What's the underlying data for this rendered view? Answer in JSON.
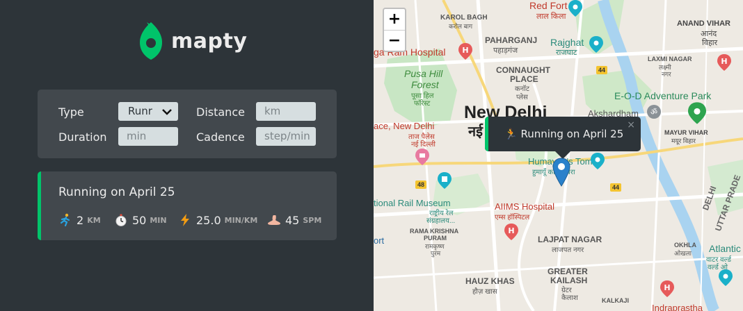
{
  "app": {
    "name": "mapty"
  },
  "form": {
    "type_label": "Type",
    "type_value": "Runr",
    "distance_label": "Distance",
    "distance_placeholder": "km",
    "duration_label": "Duration",
    "duration_placeholder": "min",
    "cadence_label": "Cadence",
    "cadence_placeholder": "step/min"
  },
  "workouts": [
    {
      "title": "Running on April 25",
      "distance": "2",
      "distance_unit": "km",
      "duration": "50",
      "duration_unit": "min",
      "pace": "25.0",
      "pace_unit": "min/km",
      "cadence": "45",
      "cadence_unit": "spm"
    }
  ],
  "map": {
    "zoom_in": "+",
    "zoom_out": "−",
    "popup_text": "🏃 Running on April 25",
    "popup_close": "×",
    "labels": {
      "red_fort": "Red Fort",
      "red_fort_hi": "लाल किला",
      "karol_bagh": "KAROL BAGH",
      "karol_bagh_hi": "करोल बाग",
      "paharganj": "PAHARGANJ",
      "paharganj_hi": "पहाड़गंज",
      "rajghat": "Rajghat",
      "rajghat_hi": "राजघाट",
      "anand_vihar": "ANAND VIHAR",
      "anand_vihar_hi1": "आनंद",
      "anand_vihar_hi2": "विहार",
      "ram_hospital": "ga Ram Hospital",
      "pusa_hill_forest_1": "Pusa Hill",
      "pusa_hill_forest_2": "Forest",
      "pusa_hill_hi_1": "पूसा हिल",
      "pusa_hill_hi_2": "फॉरेस्ट",
      "connaught_1": "CONNAUGHT",
      "connaught_2": "PLACE",
      "connaught_hi_1": "कनॉट",
      "connaught_hi_2": "प्लेस",
      "laxmi_nagar": "LAXMI NAGAR",
      "laxmi_nagar_hi_1": "लक्ष्मी",
      "laxmi_nagar_hi_2": "नगर",
      "eod": "E-O-D Adventure Park",
      "new_delhi": "New Delhi",
      "new_delhi_hi": "नई",
      "akshardham": "Akshardham",
      "mayur_vihar": "MAYUR VIHAR",
      "mayur_vihar_hi": "मयूर विहार",
      "taj_palace": "ace, New Delhi",
      "taj_hi_1": "ताज पैलेस",
      "taj_hi_2": "नई दिल्ली",
      "humayun": "Humayun's Tomb",
      "humayun_hi": "हुमायूँ का मकबरा",
      "rail_museum": "tional Rail Museum",
      "rail_hi_1": "राष्ट्रीय रेल",
      "rail_hi_2": "संग्रहालय...",
      "aiims": "AIIMS Hospital",
      "aiims_hi": "एम्स हॉस्पिटल",
      "delhi": "DELHI",
      "uttar_prade": "UTTAR PRADE",
      "rama_krishna_1": "RAMA KRISHNA",
      "rama_krishna_2": "PURAM",
      "rama_krishna_hi_1": "रामकृष्ण",
      "rama_krishna_hi_2": "पुरम",
      "lajpat": "LAJPAT NAGAR",
      "lajpat_hi": "लाजपत नगर",
      "okhla": "OKHLA",
      "okhla_hi": "ओखला",
      "atlantic_1": "Atlantic",
      "atlantic_2": "वाटर वर्ल्ड",
      "atlantic_3": "वर्ल्ड ओ",
      "ort": "ort",
      "greater_kailash_1": "GREATER",
      "greater_kailash_2": "KAILASH",
      "gk_hi_1": "ग्रेटर",
      "gk_hi_2": "कैलाश",
      "hauz_khas": "HAUZ KHAS",
      "hauz_khas_hi": "हौज़ खास",
      "kalkaji": "KALKAJI",
      "indraprastha": "Indraprastha",
      "route_44a": "44",
      "route_44b": "44",
      "route_48": "48"
    }
  },
  "colors": {
    "sidebar_bg": "#2d3439",
    "card_bg": "#42484d",
    "accent_green": "#00c46a",
    "text_light": "#ececec"
  }
}
